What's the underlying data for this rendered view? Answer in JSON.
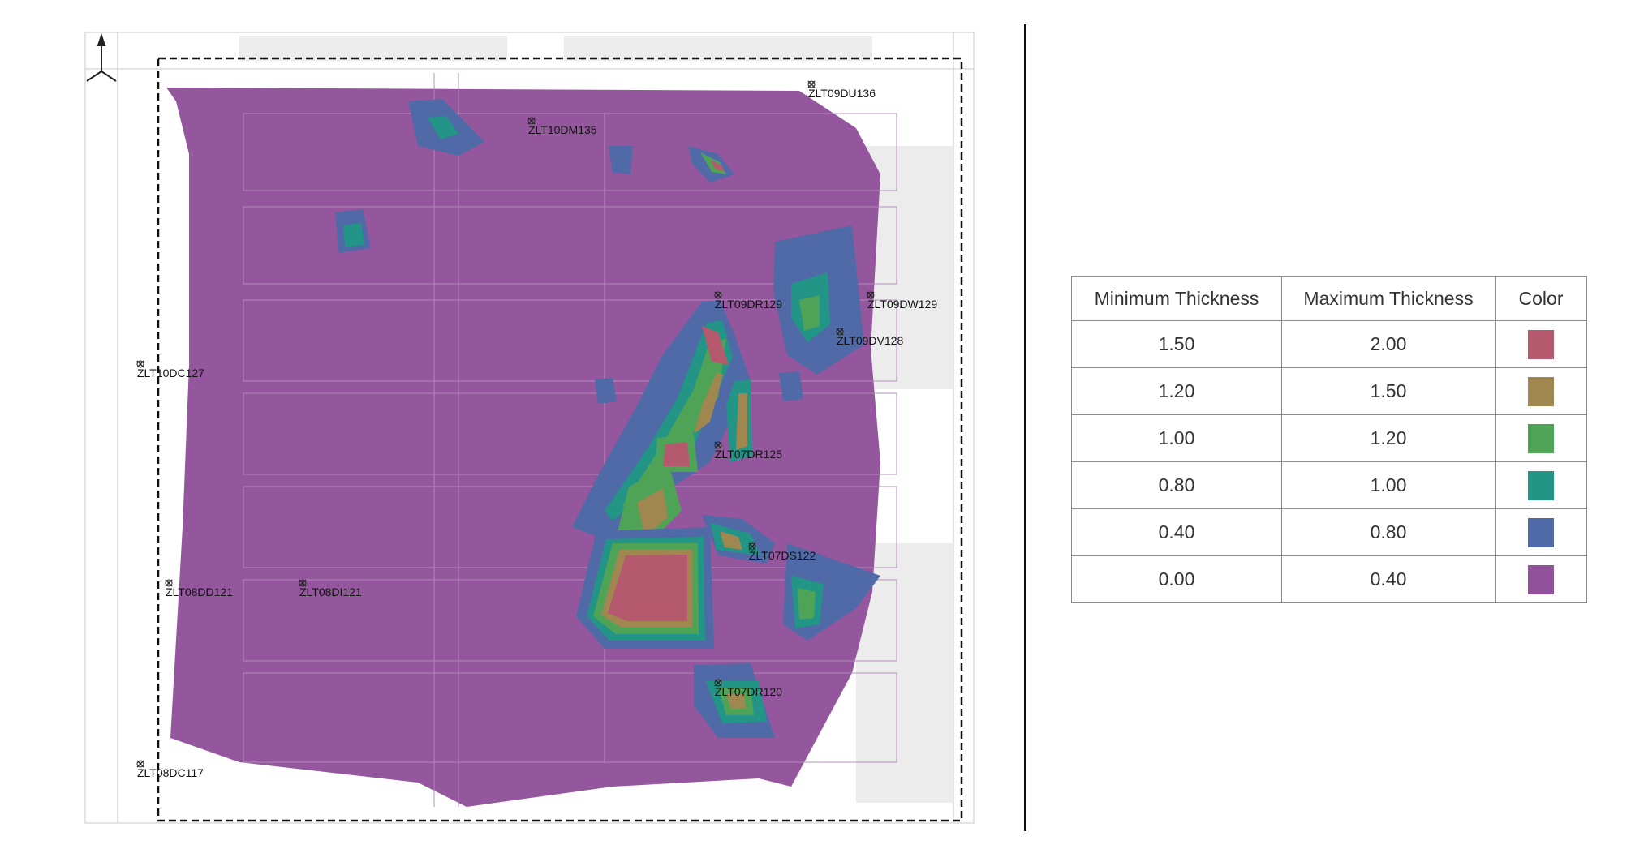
{
  "map": {
    "wells": [
      {
        "id": "ZLT09DU136"
      },
      {
        "id": "ZLT10DM135"
      },
      {
        "id": "ZLT09DR129"
      },
      {
        "id": "ZLT09DW129"
      },
      {
        "id": "ZLT09DV128"
      },
      {
        "id": "ZLT10DC127"
      },
      {
        "id": "ZLT07DR125"
      },
      {
        "id": "ZLT07DS122"
      },
      {
        "id": "ZLT08DD121"
      },
      {
        "id": "ZLT08DI121"
      },
      {
        "id": "ZLT07DR120"
      },
      {
        "id": "ZLT08DC117"
      }
    ],
    "icons": {
      "north_arrow": "north-arrow-icon",
      "well_marker": "well-marker-icon"
    }
  },
  "legend": {
    "headers": {
      "min": "Minimum Thickness",
      "max": "Maximum Thickness",
      "color": "Color"
    },
    "rows": [
      {
        "min": "1.50",
        "max": "2.00",
        "color": "#b55a6e"
      },
      {
        "min": "1.20",
        "max": "1.50",
        "color": "#a08750"
      },
      {
        "min": "1.00",
        "max": "1.20",
        "color": "#4fa357"
      },
      {
        "min": "0.80",
        "max": "1.00",
        "color": "#229587"
      },
      {
        "min": "0.40",
        "max": "0.80",
        "color": "#4f6aa6"
      },
      {
        "min": "0.00",
        "max": "0.40",
        "color": "#91529b"
      }
    ]
  }
}
